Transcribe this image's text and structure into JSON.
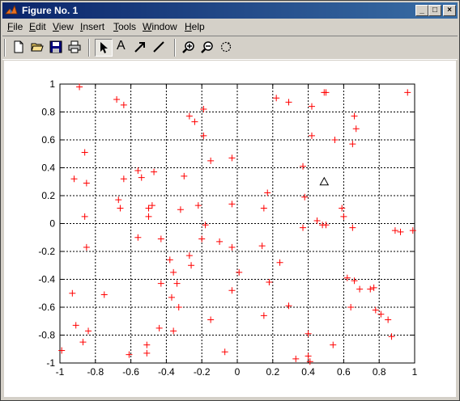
{
  "window": {
    "title": "Figure No. 1",
    "minimize_label": "_",
    "maximize_label": "□",
    "close_label": "×"
  },
  "menu": [
    {
      "label": "File",
      "accel": "F",
      "rest": "ile"
    },
    {
      "label": "Edit",
      "accel": "E",
      "rest": "dit"
    },
    {
      "label": "View",
      "accel": "V",
      "rest": "iew"
    },
    {
      "label": "Insert",
      "accel": "I",
      "rest": "nsert"
    },
    {
      "label": "Tools",
      "accel": "T",
      "rest": "ools"
    },
    {
      "label": "Window",
      "accel": "W",
      "rest": "indow"
    },
    {
      "label": "Help",
      "accel": "H",
      "rest": "elp"
    }
  ],
  "toolbar": {
    "icons": [
      "new-figure-icon",
      "open-file-icon",
      "save-icon",
      "print-icon",
      "edit-plot-arrow-icon",
      "insert-text-icon",
      "insert-arrow-icon",
      "insert-line-icon",
      "zoom-in-icon",
      "zoom-out-icon",
      "rotate-3d-icon"
    ],
    "text_tool_label": "A"
  },
  "colors": {
    "marker": "#ff0000",
    "triangle": "#000000"
  },
  "chart_data": {
    "type": "scatter",
    "title": "",
    "xlabel": "",
    "ylabel": "",
    "xlim": [
      -1,
      1
    ],
    "ylim": [
      -1,
      1
    ],
    "grid": true,
    "xticks": [
      "-1",
      "-0.8",
      "-0.6",
      "-0.4",
      "-0.2",
      "0",
      "0.2",
      "0.4",
      "0.6",
      "0.8",
      "1"
    ],
    "yticks": [
      "1",
      "0.8",
      "0.6",
      "0.4",
      "0.2",
      "0",
      "-0.2",
      "-0.4",
      "-0.6",
      "-0.8",
      "-1"
    ],
    "series": [
      {
        "marker": "plus",
        "color": "#ff0000",
        "points": [
          [
            -0.89,
            0.98
          ],
          [
            -0.68,
            0.89
          ],
          [
            -0.64,
            0.85
          ],
          [
            -0.86,
            0.51
          ],
          [
            -0.27,
            0.77
          ],
          [
            -0.24,
            0.73
          ],
          [
            -0.19,
            0.82
          ],
          [
            -0.19,
            0.63
          ],
          [
            0.22,
            0.9
          ],
          [
            0.29,
            0.87
          ],
          [
            0.42,
            0.84
          ],
          [
            0.49,
            0.94
          ],
          [
            0.5,
            0.94
          ],
          [
            0.96,
            0.94
          ],
          [
            0.66,
            0.77
          ],
          [
            0.67,
            0.68
          ],
          [
            0.42,
            0.63
          ],
          [
            0.55,
            0.6
          ],
          [
            0.65,
            0.57
          ],
          [
            -0.92,
            0.32
          ],
          [
            -0.85,
            0.29
          ],
          [
            -0.64,
            0.32
          ],
          [
            -0.56,
            0.38
          ],
          [
            -0.54,
            0.33
          ],
          [
            -0.47,
            0.37
          ],
          [
            -0.3,
            0.34
          ],
          [
            -0.15,
            0.45
          ],
          [
            -0.03,
            0.47
          ],
          [
            0.37,
            0.41
          ],
          [
            0.17,
            0.22
          ],
          [
            0.38,
            0.19
          ],
          [
            -0.67,
            0.17
          ],
          [
            -0.66,
            0.11
          ],
          [
            -0.5,
            0.11
          ],
          [
            -0.48,
            0.13
          ],
          [
            -0.5,
            0.05
          ],
          [
            -0.32,
            0.1
          ],
          [
            -0.22,
            0.13
          ],
          [
            -0.03,
            0.14
          ],
          [
            0.15,
            0.11
          ],
          [
            0.59,
            0.11
          ],
          [
            -0.86,
            0.05
          ],
          [
            0.6,
            0.05
          ],
          [
            0.45,
            0.02
          ],
          [
            0.48,
            -0.01
          ],
          [
            0.5,
            -0.01
          ],
          [
            0.65,
            -0.03
          ],
          [
            0.37,
            -0.03
          ],
          [
            -0.18,
            -0.01
          ],
          [
            0.89,
            -0.05
          ],
          [
            0.92,
            -0.06
          ],
          [
            0.99,
            -0.05
          ],
          [
            -0.85,
            -0.17
          ],
          [
            -0.56,
            -0.1
          ],
          [
            -0.43,
            -0.11
          ],
          [
            -0.2,
            -0.11
          ],
          [
            -0.1,
            -0.13
          ],
          [
            -0.03,
            -0.17
          ],
          [
            0.14,
            -0.16
          ],
          [
            0.24,
            -0.28
          ],
          [
            -0.27,
            -0.23
          ],
          [
            -0.26,
            -0.3
          ],
          [
            -0.38,
            -0.26
          ],
          [
            -0.36,
            -0.35
          ],
          [
            0.01,
            -0.35
          ],
          [
            -0.34,
            -0.43
          ],
          [
            -0.43,
            -0.43
          ],
          [
            0.18,
            -0.42
          ],
          [
            0.62,
            -0.39
          ],
          [
            0.66,
            -0.41
          ],
          [
            0.69,
            -0.47
          ],
          [
            0.75,
            -0.47
          ],
          [
            0.77,
            -0.46
          ],
          [
            -0.93,
            -0.5
          ],
          [
            -0.75,
            -0.51
          ],
          [
            -0.37,
            -0.53
          ],
          [
            -0.03,
            -0.48
          ],
          [
            -0.33,
            -0.6
          ],
          [
            0.29,
            -0.59
          ],
          [
            0.64,
            -0.6
          ],
          [
            0.78,
            -0.62
          ],
          [
            0.81,
            -0.65
          ],
          [
            0.85,
            -0.69
          ],
          [
            0.15,
            -0.66
          ],
          [
            -0.91,
            -0.73
          ],
          [
            -0.84,
            -0.77
          ],
          [
            -0.44,
            -0.75
          ],
          [
            -0.36,
            -0.77
          ],
          [
            -0.15,
            -0.69
          ],
          [
            0.4,
            -0.79
          ],
          [
            0.87,
            -0.81
          ],
          [
            -0.87,
            -0.85
          ],
          [
            -0.51,
            -0.87
          ],
          [
            -0.61,
            -0.94
          ],
          [
            -0.51,
            -0.93
          ],
          [
            -0.07,
            -0.92
          ],
          [
            0.33,
            -0.97
          ],
          [
            0.4,
            -0.95
          ],
          [
            0.41,
            -0.99
          ],
          [
            0.54,
            -0.87
          ],
          [
            -0.99,
            -0.91
          ]
        ]
      },
      {
        "marker": "triangle",
        "color": "#000000",
        "points": [
          [
            0.49,
            0.3
          ]
        ]
      }
    ]
  }
}
